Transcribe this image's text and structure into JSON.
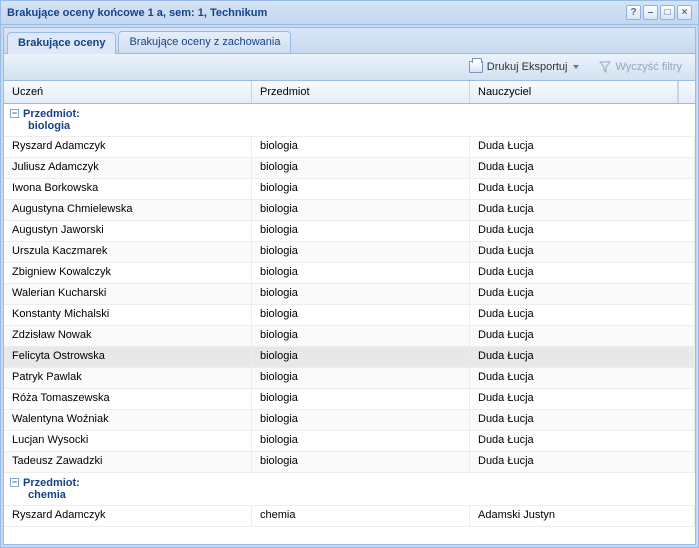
{
  "window": {
    "title": "Brakujące oceny końcowe 1 a, sem: 1, Technikum"
  },
  "tabs": [
    {
      "label": "Brakujące oceny",
      "active": true
    },
    {
      "label": "Brakujące oceny z zachowania",
      "active": false
    }
  ],
  "toolbar": {
    "print_export": "Drukuj  Eksportuj",
    "clear_filters": "Wyczyść filtry"
  },
  "columns": {
    "student": "Uczeń",
    "subject": "Przedmiot",
    "teacher": "Nauczyciel"
  },
  "group_label": "Przedmiot:",
  "groups": [
    {
      "value": "biologia",
      "rows": [
        {
          "student": "Ryszard Adamczyk",
          "subject": "biologia",
          "teacher": "Duda Łucja"
        },
        {
          "student": "Juliusz Adamczyk",
          "subject": "biologia",
          "teacher": "Duda Łucja"
        },
        {
          "student": "Iwona Borkowska",
          "subject": "biologia",
          "teacher": "Duda Łucja"
        },
        {
          "student": "Augustyna Chmielewska",
          "subject": "biologia",
          "teacher": "Duda Łucja"
        },
        {
          "student": "Augustyn Jaworski",
          "subject": "biologia",
          "teacher": "Duda Łucja"
        },
        {
          "student": "Urszula Kaczmarek",
          "subject": "biologia",
          "teacher": "Duda Łucja"
        },
        {
          "student": "Zbigniew Kowalczyk",
          "subject": "biologia",
          "teacher": "Duda Łucja"
        },
        {
          "student": "Walerian Kucharski",
          "subject": "biologia",
          "teacher": "Duda Łucja"
        },
        {
          "student": "Konstanty Michalski",
          "subject": "biologia",
          "teacher": "Duda Łucja"
        },
        {
          "student": "Zdzisław Nowak",
          "subject": "biologia",
          "teacher": "Duda Łucja"
        },
        {
          "student": "Felicyta Ostrowska",
          "subject": "biologia",
          "teacher": "Duda Łucja",
          "selected": true
        },
        {
          "student": "Patryk Pawlak",
          "subject": "biologia",
          "teacher": "Duda Łucja"
        },
        {
          "student": "Róża Tomaszewska",
          "subject": "biologia",
          "teacher": "Duda Łucja"
        },
        {
          "student": "Walentyna Woźniak",
          "subject": "biologia",
          "teacher": "Duda Łucja"
        },
        {
          "student": "Lucjan Wysocki",
          "subject": "biologia",
          "teacher": "Duda Łucja"
        },
        {
          "student": "Tadeusz Zawadzki",
          "subject": "biologia",
          "teacher": "Duda Łucja"
        }
      ]
    },
    {
      "value": "chemia",
      "rows": [
        {
          "student": "Ryszard Adamczyk",
          "subject": "chemia",
          "teacher": "Adamski Justyn"
        }
      ]
    }
  ]
}
